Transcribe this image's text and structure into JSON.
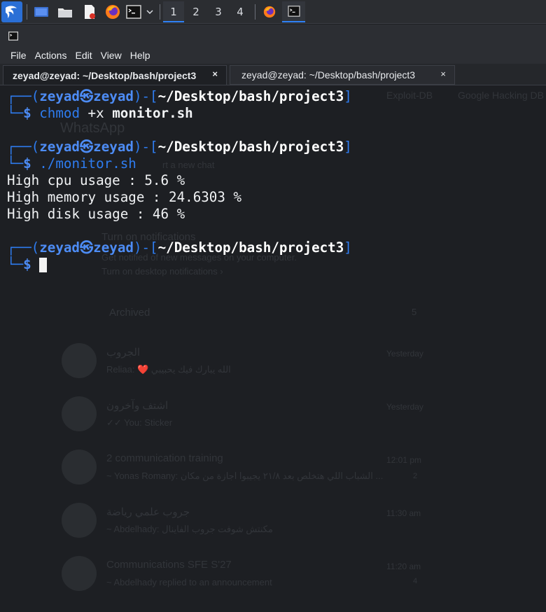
{
  "workspaces": [
    "1",
    "2",
    "3",
    "4"
  ],
  "menu": [
    "File",
    "Actions",
    "Edit",
    "View",
    "Help"
  ],
  "tabs": [
    {
      "label": "zeyad@zeyad: ~/Desktop/bash/project3",
      "close": "×"
    },
    {
      "label": "zeyad@zeyad: ~/Desktop/bash/project3",
      "close": "×"
    }
  ],
  "prompt": {
    "open": "┌──(",
    "user": "zeyad",
    "at": "㉿",
    "host": "zeyad",
    "mid": ")-[",
    "path": "~/Desktop/bash/project3",
    "close": "]",
    "corner": "└─",
    "dollar": "$"
  },
  "commands": [
    {
      "cmd": "chmod",
      "args": " +x ",
      "file": "monitor.sh"
    },
    {
      "cmd": "./monitor.sh"
    }
  ],
  "output": [
    "High cpu usage : 5.6 %",
    "High memory usage : 24.6303 %",
    "High disk usage : 46 %"
  ],
  "background": {
    "app": "WhatsApp",
    "bookmarks": [
      "Exploit-DB",
      "Google Hacking DB"
    ],
    "start_chat": "rt a new chat",
    "notif_title": "Turn on notifications",
    "notif_body": "Get notified of new messages on your computer.",
    "notif_link": "Turn on desktop notifications ›",
    "archived": "Archived",
    "archived_count": "5",
    "chats": [
      {
        "name": "الجروب",
        "preview": "Reliaa: ❤️ الله يبارك فيك يحبيبي",
        "time": "Yesterday"
      },
      {
        "name": "اشتف وآخرون",
        "preview": "✓✓ You: Sticker",
        "time": "Yesterday"
      },
      {
        "name": "2 communication training",
        "preview": "~ Yonas Romany: الشباب اللي هتخلص بعد ٢١/٨ يجيبوا اجازة من مكان ...",
        "time": "12:01 pm",
        "badge": "2"
      },
      {
        "name": "جروب علمي رياضة",
        "preview": "~ Abdelhady: مكنتش شوفت جروب الفاينال",
        "time": "11:30 am"
      },
      {
        "name": "Communications SFE S'27",
        "preview": "~ Abdelhady replied to an announcement",
        "time": "11:20 am",
        "badge": "4"
      }
    ]
  }
}
